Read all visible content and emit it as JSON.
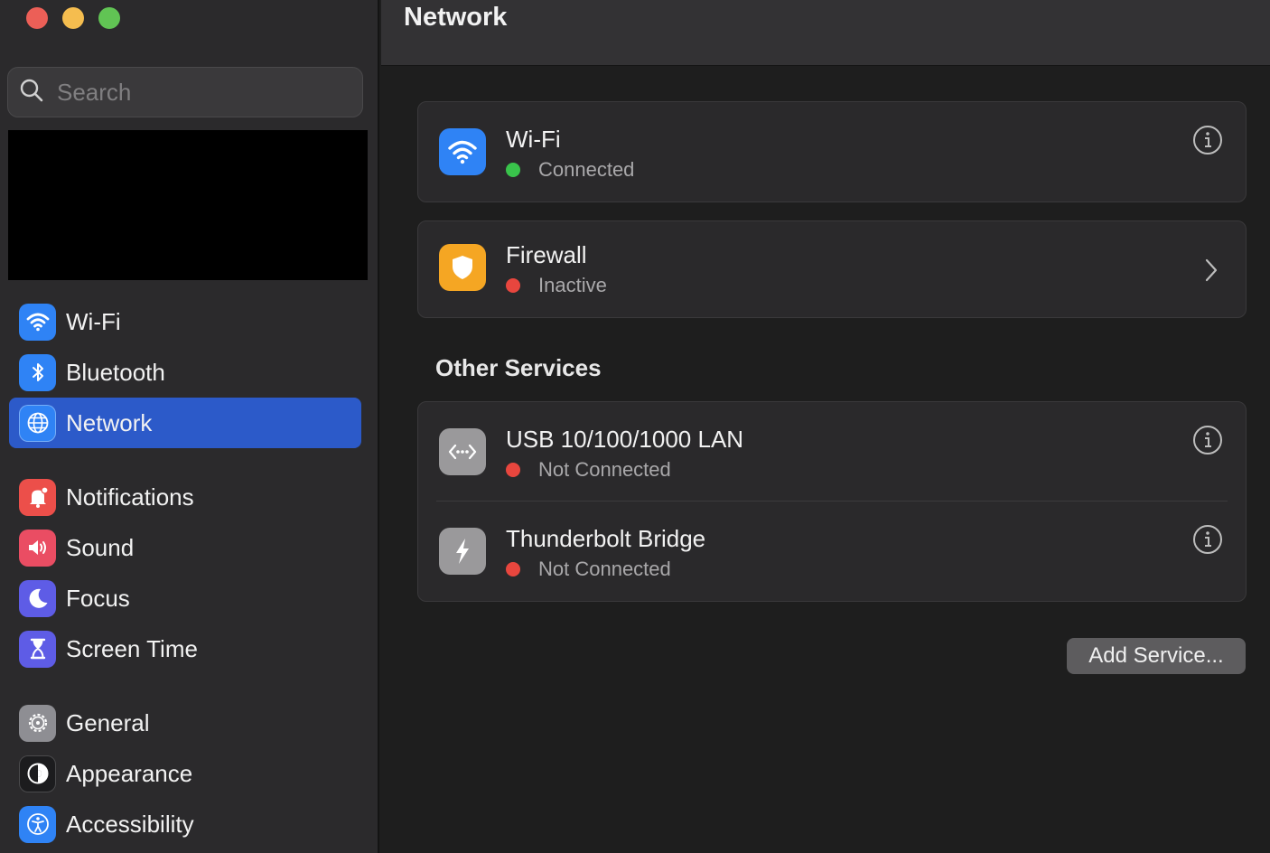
{
  "window": {
    "traffic_lights": {
      "close": "#ec5f57",
      "minimize": "#f5bd4f",
      "zoom": "#61c454"
    }
  },
  "sidebar": {
    "search_placeholder": "Search",
    "items": [
      {
        "label": "Wi-Fi",
        "icon": "wifi-icon",
        "color": "#2f83f5",
        "active": false
      },
      {
        "label": "Bluetooth",
        "icon": "bluetooth-icon",
        "color": "#2f83f5",
        "active": false
      },
      {
        "label": "Network",
        "icon": "globe-icon",
        "color": "#2f83f5",
        "active": true
      },
      {
        "label": "Notifications",
        "icon": "bell-icon",
        "color": "#ec4f4a",
        "active": false
      },
      {
        "label": "Sound",
        "icon": "speaker-icon",
        "color": "#ea4d63",
        "active": false
      },
      {
        "label": "Focus",
        "icon": "moon-icon",
        "color": "#5e5ce6",
        "active": false
      },
      {
        "label": "Screen Time",
        "icon": "hourglass-icon",
        "color": "#5e5ce6",
        "active": false
      },
      {
        "label": "General",
        "icon": "gear-icon",
        "color": "#8e8e93",
        "active": false
      },
      {
        "label": "Appearance",
        "icon": "appearance-icon",
        "color": "#1c1c1e",
        "active": false
      },
      {
        "label": "Accessibility",
        "icon": "accessibility-icon",
        "color": "#2f83f5",
        "active": false
      }
    ]
  },
  "main": {
    "title": "Network",
    "services": [
      {
        "name": "Wi-Fi",
        "status": "Connected",
        "status_color": "#39c34b",
        "icon": "wifi-icon",
        "icon_color": "#2f83f5",
        "action": "info-icon"
      },
      {
        "name": "Firewall",
        "status": "Inactive",
        "status_color": "#e8463e",
        "icon": "shield-icon",
        "icon_color": "#f5a623",
        "action": "chevron-right-icon"
      }
    ],
    "other_services_title": "Other Services",
    "other_services": [
      {
        "name": "USB 10/100/1000 LAN",
        "status": "Not Connected",
        "status_color": "#e8463e",
        "icon": "ethernet-icon",
        "icon_color": "#9a999b",
        "action": "info-icon"
      },
      {
        "name": "Thunderbolt Bridge",
        "status": "Not Connected",
        "status_color": "#e8463e",
        "icon": "thunderbolt-icon",
        "icon_color": "#9a999b",
        "action": "info-icon"
      }
    ],
    "add_service_label": "Add Service..."
  }
}
